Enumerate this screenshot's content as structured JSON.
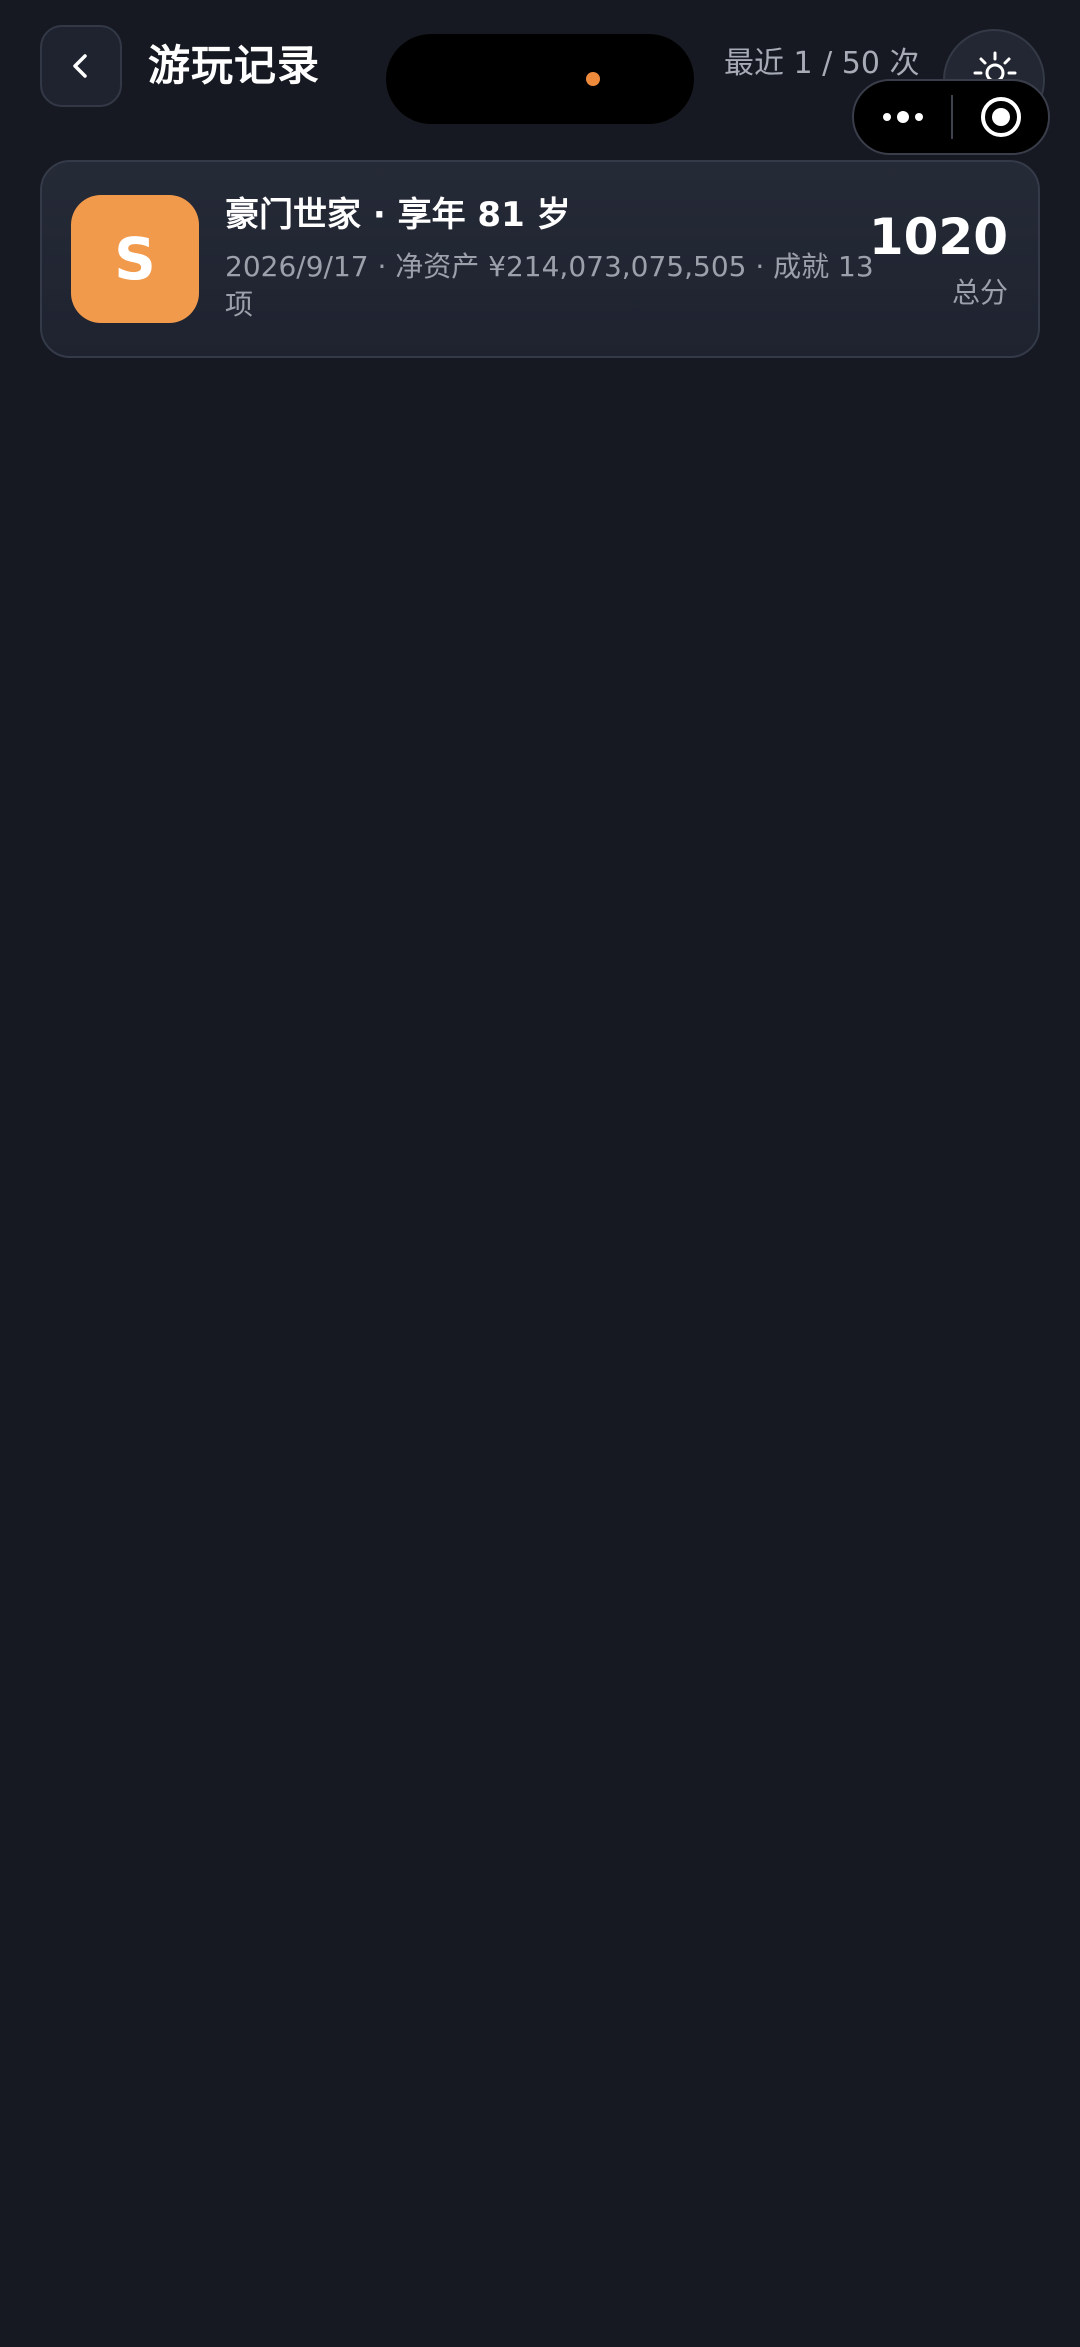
{
  "header": {
    "title": "游玩记录",
    "record_count": "最近 1 / 50 次"
  },
  "records": [
    {
      "grade": "S",
      "title": "豪门世家 · 享年 81 岁",
      "meta": "2026/9/17 · 净资产 ¥214,073,075,505 · 成就 13 项",
      "score": "1020",
      "score_label": "总分"
    }
  ],
  "colors": {
    "background": "#161922",
    "card": "#232835",
    "grade_badge": "#f29a4c",
    "island_dot": "#ee8a3c"
  },
  "icons": {
    "back": "chevron-left-icon",
    "settings": "sun-gear-icon",
    "more": "more-dots-icon",
    "close": "target-circle-icon"
  }
}
